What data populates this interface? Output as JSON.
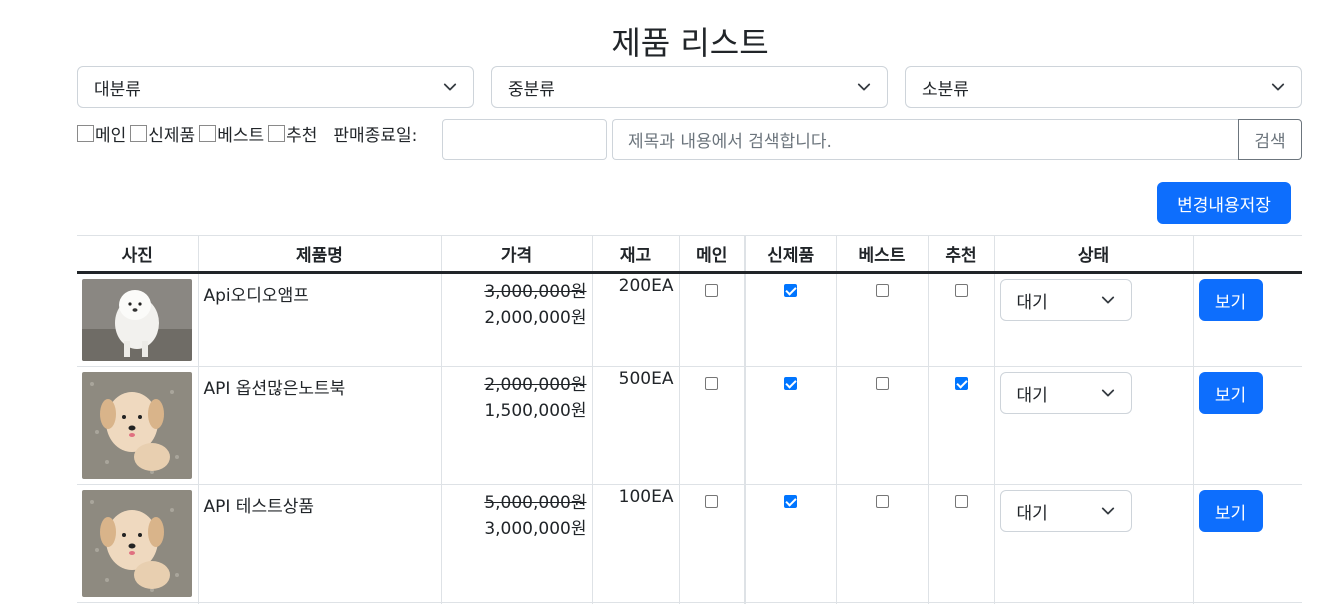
{
  "page_title": "제품 리스트",
  "categories": {
    "large": "대분류",
    "medium": "중분류",
    "small": "소분류"
  },
  "filters": {
    "main": "메인",
    "new": "신제품",
    "best": "베스트",
    "recommend": "추천",
    "sale_end_date": "판매종료일:"
  },
  "search": {
    "placeholder": "제목과 내용에서 검색합니다.",
    "button": "검색"
  },
  "save_button": "변경내용저장",
  "table": {
    "headers": [
      "사진",
      "제품명",
      "가격",
      "재고",
      "메인",
      "신제품",
      "베스트",
      "추천",
      "상태",
      ""
    ],
    "rows": [
      {
        "name": "Api오디오앰프",
        "original_price": "3,000,000원",
        "price": "2,000,000원",
        "stock": "200EA",
        "main": false,
        "new": true,
        "best": false,
        "recommend": false,
        "status": "대기",
        "view": "보기"
      },
      {
        "name": "API 옵션많은노트북",
        "original_price": "2,000,000원",
        "price": "1,500,000원",
        "stock": "500EA",
        "main": false,
        "new": true,
        "best": false,
        "recommend": true,
        "status": "대기",
        "view": "보기"
      },
      {
        "name": "API 테스트상품",
        "original_price": "5,000,000원",
        "price": "3,000,000원",
        "stock": "100EA",
        "main": false,
        "new": true,
        "best": false,
        "recommend": false,
        "status": "대기",
        "view": "보기"
      }
    ]
  },
  "icons": {
    "dropdown": "chevron-down-icon"
  }
}
